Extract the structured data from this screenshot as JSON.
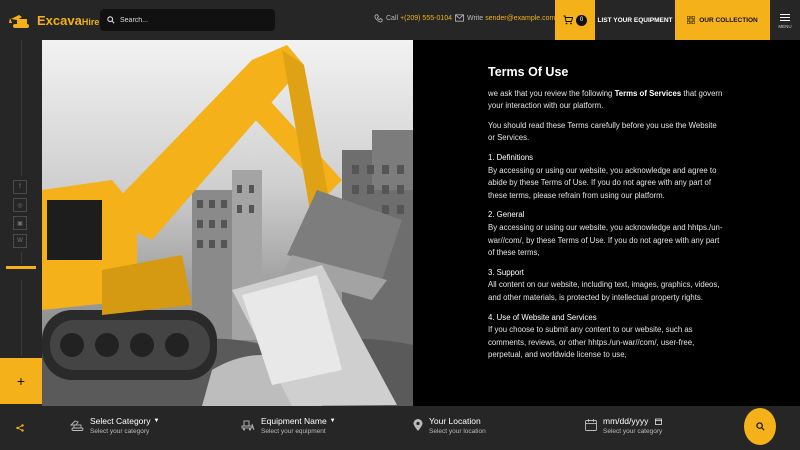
{
  "header": {
    "brand": "Excava",
    "brand_suffix": "Hire",
    "search_placeholder": "Search...",
    "call_label": "Call",
    "call_value": "+(209) 555-0104",
    "email_label": "Write",
    "email_value": "sender@example.com",
    "cart_count": "0",
    "list_equipment": "LIST YOUR EQUIPMENT",
    "our_collection": "OUR COLLECTION",
    "menu_label": "MENU"
  },
  "sidebar": {
    "social": [
      {
        "icon": "facebook-icon",
        "glyph": "f"
      },
      {
        "icon": "instagram-icon",
        "glyph": "◎"
      },
      {
        "icon": "discord-icon",
        "glyph": "▣"
      },
      {
        "icon": "webflow-icon",
        "glyph": "W"
      }
    ],
    "plus": "+"
  },
  "terms": {
    "title": "Terms Of Use",
    "intro_pre": "we ask that you review the following ",
    "intro_bold": "Terms of Services",
    "intro_post": " that govern your interaction with our platform.",
    "read_note": "You should read these Terms carefully before you use the Website or Services.",
    "sections": [
      {
        "title": "1. Definitions",
        "body": "By accessing or using our website, you acknowledge and agree to abide by these Terms of Use. If you do not agree with any part of these terms, please refrain from using our platform."
      },
      {
        "title": "2. General",
        "body": "By accessing or using our website, you acknowledge and hhtps./un-war//com/, by these Terms of Use. If you do not agree with any part of these terms,"
      },
      {
        "title": "3. Support",
        "body": "All content on our website, including text, images, graphics, videos, and other materials, is protected by intellectual property rights."
      },
      {
        "title": "4. Use of Website and Services",
        "body": "If you choose to submit any content to our website, such as comments, reviews, or other hhtps./un-war//com/, user-free, perpetual, and worldwide license to use,"
      }
    ]
  },
  "bottom_bar": {
    "category_title": "Select Category",
    "category_sub": "Select your category",
    "equipment_title": "Equipment Name",
    "equipment_sub": "Select your equipment",
    "location_title": "Your Location",
    "location_sub": "Select your location",
    "date_placeholder": "mm/dd/yyyy",
    "date_sub": "Select your category"
  },
  "colors": {
    "accent": "#f4b11a",
    "panel": "#262626",
    "background": "#000000"
  }
}
